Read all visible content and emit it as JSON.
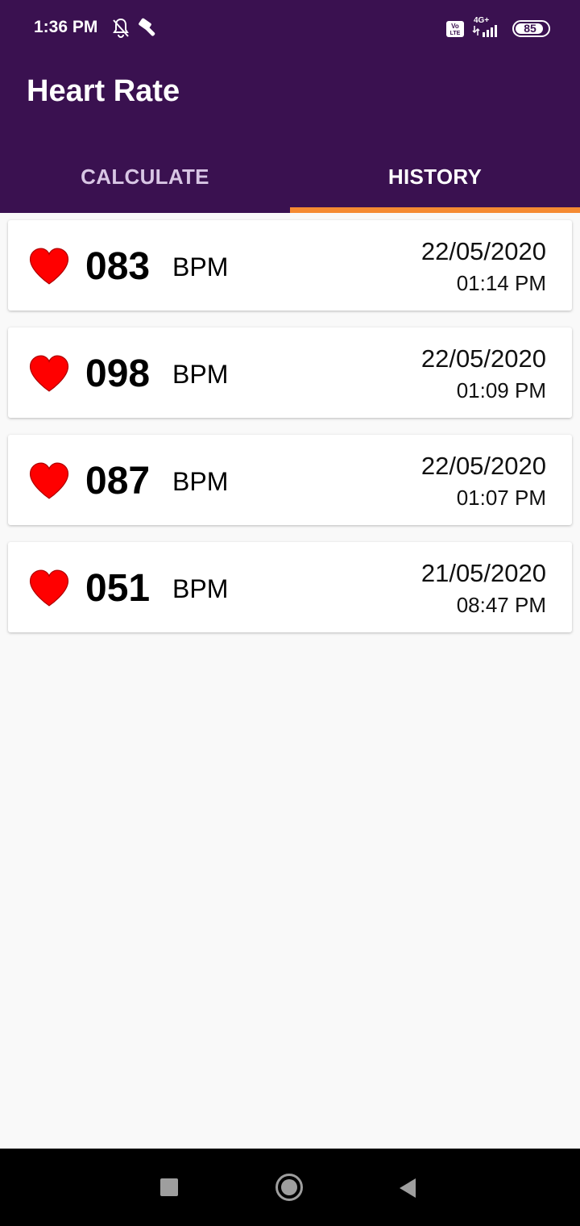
{
  "status_bar": {
    "time": "1:36 PM",
    "network_label": "4G+",
    "volte_label": "Vo LTE",
    "battery": "85",
    "icons": [
      "mute-bell-icon",
      "hammer-icon",
      "volte-icon",
      "signal-icon",
      "battery-icon"
    ]
  },
  "app": {
    "title": "Heart Rate"
  },
  "tabs": [
    {
      "label": "CALCULATE",
      "active": false
    },
    {
      "label": "HISTORY",
      "active": true
    }
  ],
  "history": [
    {
      "bpm": "083",
      "unit": "BPM",
      "date": "22/05/2020",
      "time": "01:14 PM"
    },
    {
      "bpm": "098",
      "unit": "BPM",
      "date": "22/05/2020",
      "time": "01:09 PM"
    },
    {
      "bpm": "087",
      "unit": "BPM",
      "date": "22/05/2020",
      "time": "01:07 PM"
    },
    {
      "bpm": "051",
      "unit": "BPM",
      "date": "21/05/2020",
      "time": "08:47 PM"
    }
  ],
  "colors": {
    "appbar": "#3a1150",
    "tab_indicator": "#f58a32",
    "heart": "#ff0000",
    "background": "#f9f9f9"
  },
  "nav_bar": {
    "icons": [
      "recents-square-icon",
      "home-circle-icon",
      "back-triangle-icon"
    ]
  }
}
